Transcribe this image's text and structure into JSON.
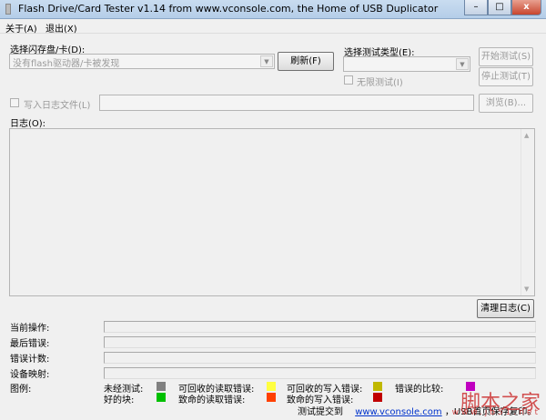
{
  "window": {
    "title": "Flash Drive/Card Tester v1.14 from www.vconsole.com, the Home of USB Duplicator",
    "minimize": "–",
    "maximize": "□",
    "close": "x"
  },
  "menu": [
    {
      "label": "关于(A)"
    },
    {
      "label": "退出(X)"
    }
  ],
  "drive": {
    "label": "选择闪存盘/卡(D):",
    "value": "没有flash驱动器/卡被发现",
    "refresh": "刷新(F)"
  },
  "test_type": {
    "label": "选择测试类型(E):",
    "value": "",
    "unlimited": "无限测试(I)",
    "start": "开始测试(S)",
    "stop": "停止测试(T)"
  },
  "logfile": {
    "label": "写入日志文件(L)",
    "value": "",
    "browse": "浏览(B)..."
  },
  "log": {
    "label": "日志(O):",
    "content": "",
    "clear": "清理日志(C)"
  },
  "status": [
    {
      "label": "当前操作:",
      "value": ""
    },
    {
      "label": "最后错误:",
      "value": ""
    },
    {
      "label": "错误计数:",
      "value": ""
    },
    {
      "label": "设备映射:",
      "value": ""
    }
  ],
  "legend": {
    "label": "图例:",
    "items": [
      {
        "label": "未经测试:",
        "color": "#808080"
      },
      {
        "label": "可回收的读取错误:",
        "color": "#ffff40"
      },
      {
        "label": "可回收的写入错误:",
        "color": "#c0b800"
      },
      {
        "label": "错误的比较:",
        "color": "#c000c0"
      },
      {
        "label": "好的块:",
        "color": "#00c000"
      },
      {
        "label": "致命的读取错误:",
        "color": "#ff4000"
      },
      {
        "label": "致命的写入错误:",
        "color": "#c00000"
      }
    ]
  },
  "footer": {
    "prefix": "测试提交到",
    "link": "www.vconsole.com",
    "suffix": "，USB首页保存复印。"
  },
  "watermark": {
    "text": "脚本之家",
    "url": "www.jb51.net"
  }
}
